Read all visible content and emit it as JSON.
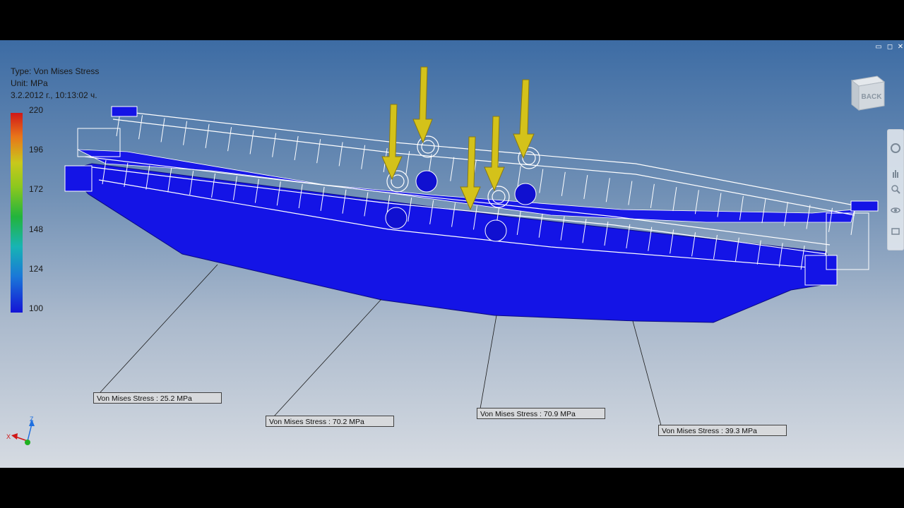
{
  "window_controls": [
    "▭",
    "◻",
    "✕"
  ],
  "result_info": {
    "type": "Type: Von Mises Stress",
    "unit": "Unit: MPa",
    "timestamp": "3.2.2012 г., 10:13:02 ч."
  },
  "legend": {
    "labels": [
      "220",
      "196",
      "172",
      "148",
      "124",
      "100"
    ]
  },
  "probes": [
    {
      "label": "Von Mises Stress : 25.2 MPa"
    },
    {
      "label": "Von Mises Stress : 70.2 MPa"
    },
    {
      "label": "Von Mises Stress : 70.9 MPa"
    },
    {
      "label": "Von Mises Stress : 39.3 MPa"
    }
  ],
  "viewcube": {
    "face_label": "BACK"
  },
  "axis_triad": {
    "z": "Z",
    "x": "X"
  },
  "colors": {
    "model": "#1414e6",
    "load_arrow": "#d4c21a",
    "wireframe": "#ffffff"
  }
}
